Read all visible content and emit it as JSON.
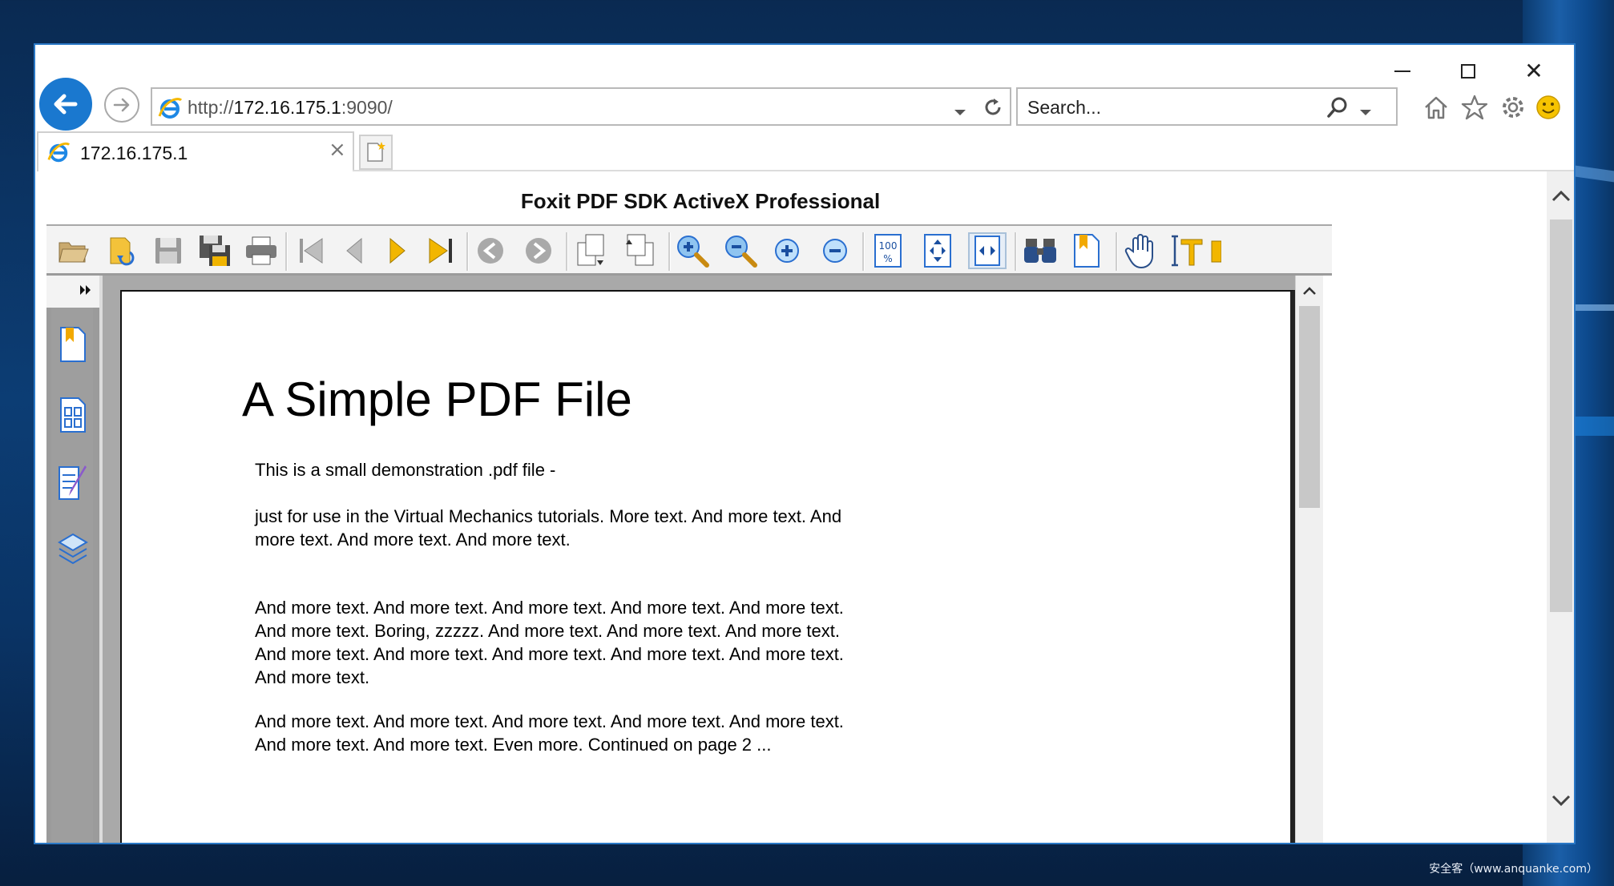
{
  "browser": {
    "address": {
      "prefix": "http://",
      "host": "172.16.175.1",
      "rest": ":9090/"
    },
    "search": {
      "placeholder": "Search..."
    },
    "tab": {
      "title": "172.16.175.1",
      "close": "×"
    },
    "window_close": "✕"
  },
  "page": {
    "title": "Foxit PDF SDK ActiveX Professional"
  },
  "pdf": {
    "heading": "A Simple PDF File",
    "paragraphs": [
      "This is a small demonstration .pdf file -",
      "just for use in the Virtual Mechanics tutorials. More text. And more text. And more text. And more text. And more text.",
      "And more text. And more text. And more text. And more text. And more text. And more text. Boring, zzzzz. And more text. And more text. And more text. And more text. And more text. And more text. And more text. And more text. And more text.",
      "And more text. And more text. And more text. And more text. And more text. And more text. And more text. Even more. Continued on page 2 ..."
    ]
  },
  "colors": {
    "accent": "#1a78cf",
    "window_border": "#2a78c6",
    "toolbar_bg": "#f3f3f3",
    "doc_bg": "#a9a9a9"
  },
  "icons": {
    "toolbar": [
      "open-icon",
      "open-url-icon",
      "save-icon",
      "save-as-icon",
      "print-icon",
      "first-page-icon",
      "prev-page-icon",
      "next-page-icon",
      "last-page-icon",
      "back-icon",
      "forward-icon",
      "rotate-left-icon",
      "rotate-right-icon",
      "zoom-in-icon",
      "zoom-out-icon",
      "zoom-in-small-icon",
      "zoom-out-small-icon",
      "actual-size-icon",
      "fit-page-icon",
      "fit-width-icon",
      "find-icon",
      "bookmark-icon",
      "hand-tool-icon",
      "text-select-icon"
    ],
    "sidebar": [
      "bookmarks-panel-icon",
      "thumbnails-panel-icon",
      "annotations-panel-icon",
      "layers-panel-icon"
    ]
  },
  "watermark": "安全客（www.anquanke.com）"
}
